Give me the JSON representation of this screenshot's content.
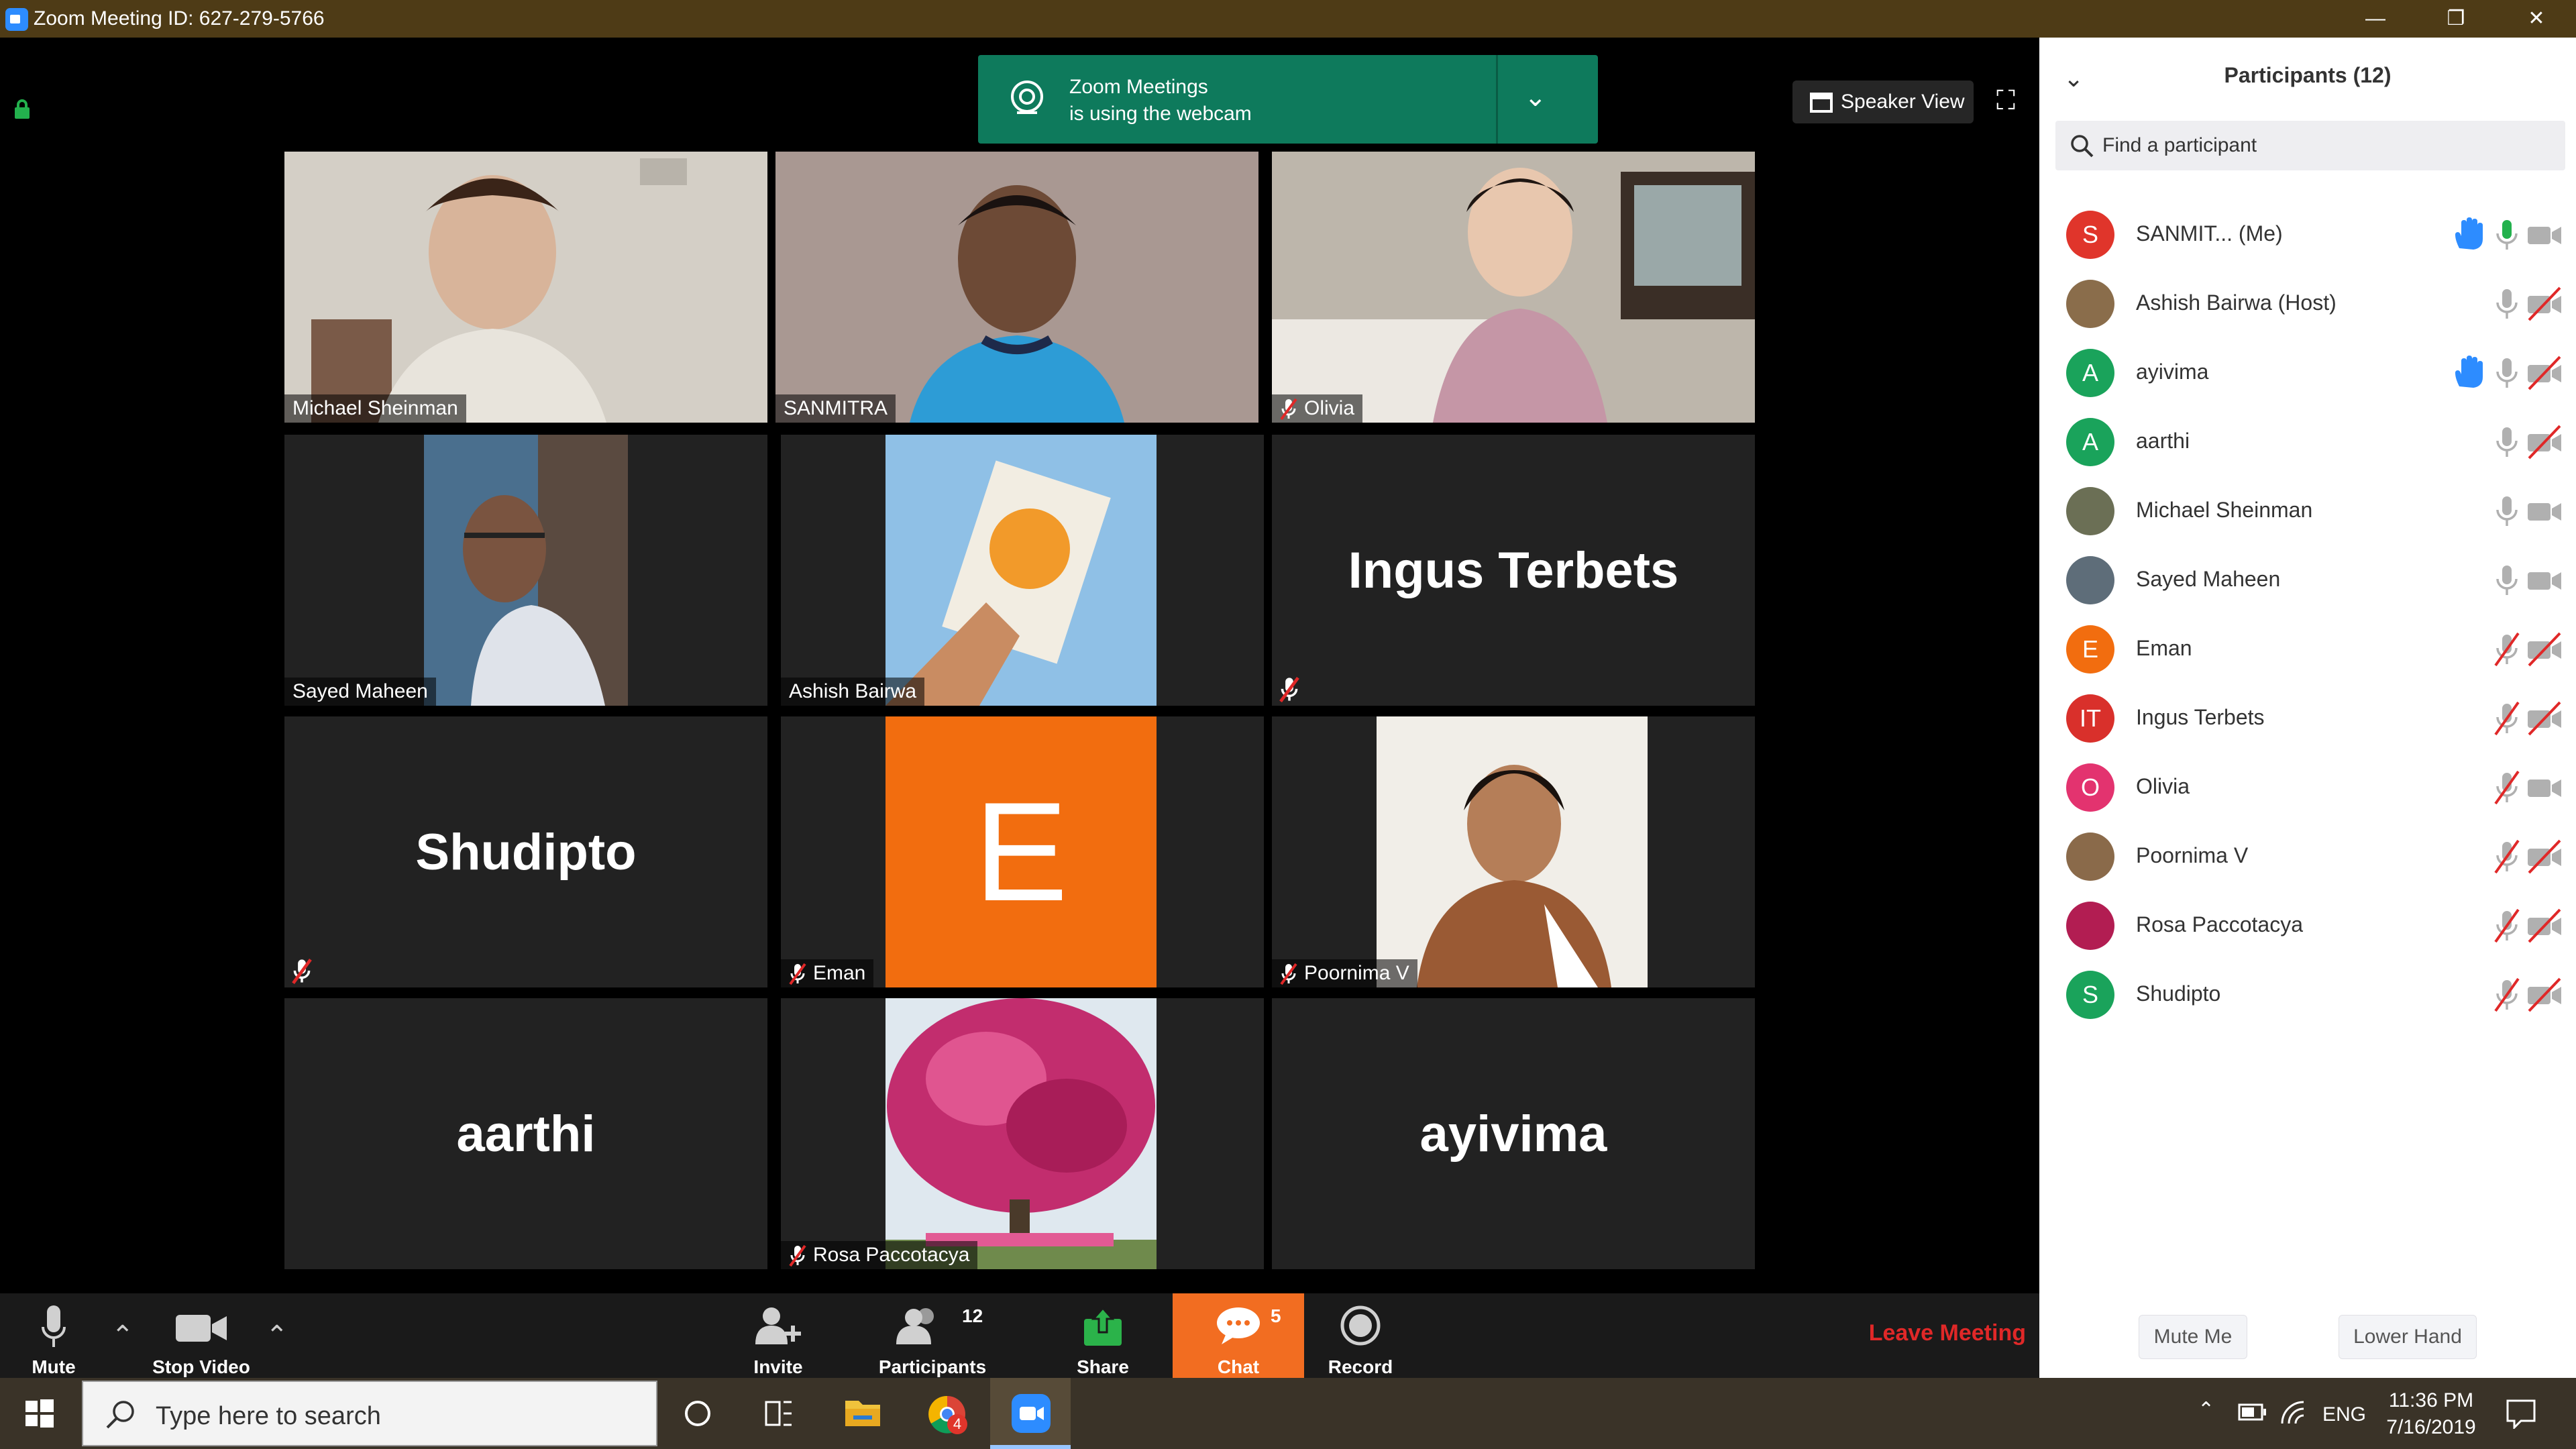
{
  "window": {
    "title": "Zoom Meeting ID: 627-279-5766",
    "minimize": "—",
    "restore": "❐",
    "close": "✕"
  },
  "notification": {
    "line1": "Zoom Meetings",
    "line2": "is using the webcam"
  },
  "view": {
    "speaker_view_label": "Speaker View"
  },
  "gallery": {
    "tiles": [
      {
        "name": "Michael Sheinman",
        "kind": "video",
        "muted": false
      },
      {
        "name": "SANMITRA",
        "kind": "video",
        "muted": false,
        "active": true
      },
      {
        "name": "Olivia",
        "kind": "video",
        "muted": true
      },
      {
        "name": "Sayed Maheen",
        "kind": "video",
        "muted": false
      },
      {
        "name": "Ashish Bairwa",
        "kind": "video",
        "muted": false
      },
      {
        "name": "Ingus Terbets",
        "kind": "name-only",
        "muted": true
      },
      {
        "name": "Shudipto",
        "kind": "name-only",
        "muted": true
      },
      {
        "name": "Eman",
        "kind": "avatar",
        "letter": "E",
        "muted": true
      },
      {
        "name": "Poornima V",
        "kind": "video",
        "muted": true
      },
      {
        "name": "aarthi",
        "kind": "name-only",
        "muted": false
      },
      {
        "name": "Rosa Paccotacya",
        "kind": "photo",
        "muted": true
      },
      {
        "name": "ayivima",
        "kind": "name-only",
        "muted": false
      }
    ]
  },
  "participants_panel": {
    "title": "Participants (12)",
    "search_placeholder": "Find a participant",
    "participants": [
      {
        "initials": "S",
        "name": "SANMIT...   (Me)",
        "color": "#e0352b",
        "hand": true,
        "mic": "active",
        "video": "on"
      },
      {
        "initials": "",
        "name": "Ashish Bairwa (Host)",
        "color": "#8a6d4b",
        "hand": false,
        "mic": "on",
        "video": "off"
      },
      {
        "initials": "A",
        "name": "ayivima",
        "color": "#1aa35b",
        "hand": true,
        "mic": "on",
        "video": "off"
      },
      {
        "initials": "A",
        "name": "aarthi",
        "color": "#1aa35b",
        "hand": false,
        "mic": "on",
        "video": "off"
      },
      {
        "initials": "",
        "name": "Michael Sheinman",
        "color": "#6b6f55",
        "hand": false,
        "mic": "on",
        "video": "on"
      },
      {
        "initials": "",
        "name": "Sayed Maheen",
        "color": "#5e6d79",
        "hand": false,
        "mic": "on",
        "video": "on"
      },
      {
        "initials": "E",
        "name": "Eman",
        "color": "#f26d0f",
        "hand": false,
        "mic": "muted",
        "video": "off"
      },
      {
        "initials": "IT",
        "name": "Ingus Terbets",
        "color": "#d9302b",
        "hand": false,
        "mic": "muted",
        "video": "off"
      },
      {
        "initials": "O",
        "name": "Olivia",
        "color": "#e3336f",
        "hand": false,
        "mic": "muted",
        "video": "on"
      },
      {
        "initials": "",
        "name": "Poornima V",
        "color": "#8a6a4a",
        "hand": false,
        "mic": "muted",
        "video": "off"
      },
      {
        "initials": "",
        "name": "Rosa Paccotacya",
        "color": "#b21d52",
        "hand": false,
        "mic": "muted",
        "video": "off"
      },
      {
        "initials": "S",
        "name": "Shudipto",
        "color": "#1aa35b",
        "hand": false,
        "mic": "muted",
        "video": "off"
      }
    ],
    "mute_me": "Mute Me",
    "lower_hand": "Lower Hand"
  },
  "toolbar": {
    "mute": "Mute",
    "stop_video": "Stop Video",
    "invite": "Invite",
    "participants": "Participants",
    "participants_count": "12",
    "share": "Share",
    "chat": "Chat",
    "chat_count": "5",
    "record": "Record",
    "leave": "Leave Meeting"
  },
  "taskbar": {
    "search_placeholder": "Type here to search",
    "badge": "4",
    "lang": "ENG",
    "time": "11:36 PM",
    "date": "7/16/2019"
  },
  "colors": {
    "accent_green": "#0e7a5c",
    "chat_orange": "#f26d21",
    "leave_red": "#e02828",
    "active_speaker": "#cde66b",
    "raised_hand_blue": "#2d8cff",
    "mic_active_green": "#23b14d"
  }
}
